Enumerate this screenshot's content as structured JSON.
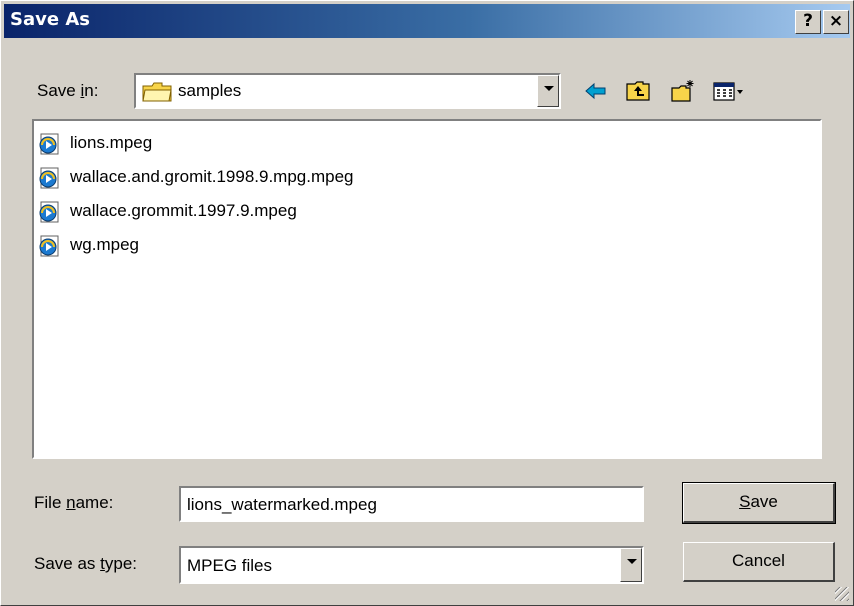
{
  "window": {
    "title": "Save As",
    "help_label": "?",
    "close_label": "×"
  },
  "save_in": {
    "label_prefix": "Save ",
    "label_underline": "i",
    "label_suffix": "n:",
    "value": "samples"
  },
  "toolbar": {
    "icons": [
      "back-icon",
      "up-folder-icon",
      "new-folder-icon",
      "view-menu-icon"
    ]
  },
  "files": [
    {
      "name": "lions.mpeg"
    },
    {
      "name": "wallace.and.gromit.1998.9.mpg.mpeg"
    },
    {
      "name": "wallace.grommit.1997.9.mpeg"
    },
    {
      "name": "wg.mpeg"
    }
  ],
  "file_name": {
    "label_prefix": "File ",
    "label_underline": "n",
    "label_suffix": "ame:",
    "value": "lions_watermarked.mpeg"
  },
  "save_as_type": {
    "label_prefix": "Save as ",
    "label_underline": "t",
    "label_suffix": "ype:",
    "value": "MPEG files"
  },
  "buttons": {
    "save_underline": "S",
    "save_rest": "ave",
    "cancel": "Cancel"
  },
  "colors": {
    "title_start": "#0a246a",
    "title_end": "#a6caf0",
    "face": "#d4d0c8",
    "folder_yellow": "#f7d44a"
  }
}
